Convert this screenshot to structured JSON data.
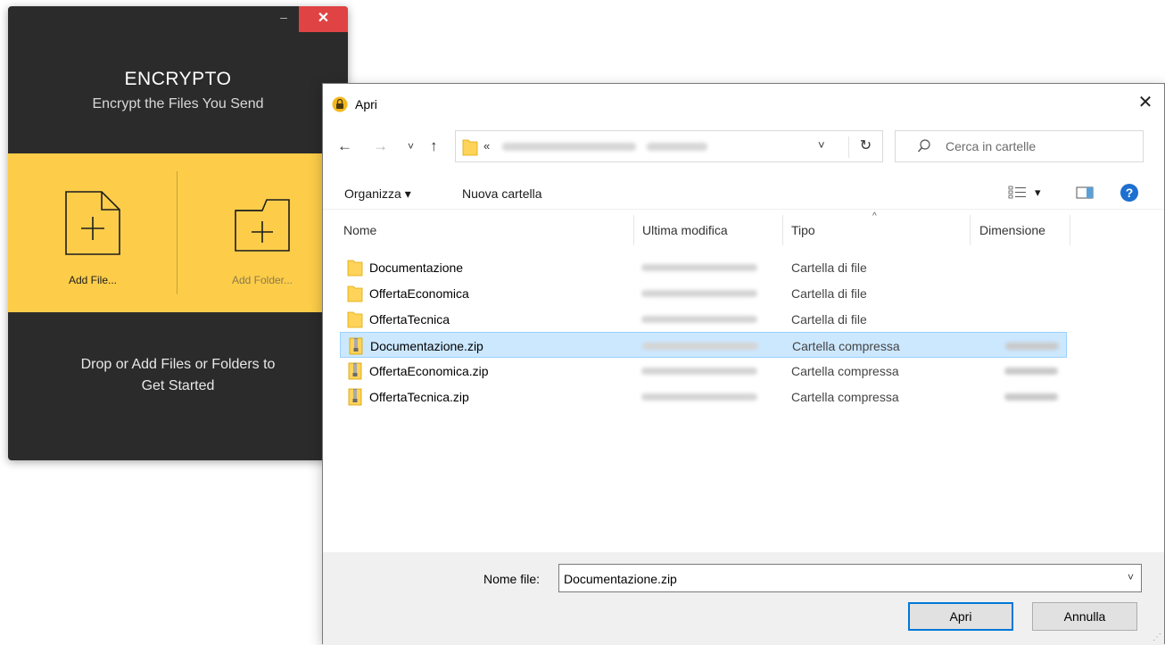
{
  "encrypto": {
    "minimize": "–",
    "close": "✕",
    "title": "ENCRYPTO",
    "subtitle": "Encrypt the Files You Send",
    "add_file": "Add File...",
    "add_folder": "Add Folder...",
    "hint_line1": "Drop or Add Files or Folders to",
    "hint_line2": "Get Started"
  },
  "dialog": {
    "title": "Apri",
    "close": "✕",
    "nav": {
      "back": "←",
      "forward": "→",
      "recent": "˅",
      "up": "↑",
      "path_prefix": "«",
      "dropdown": "˅",
      "refresh": "↻"
    },
    "search": {
      "placeholder": "Cerca in cartelle"
    },
    "toolbar": {
      "organize": "Organizza ▾",
      "new_folder": "Nuova cartella",
      "view_dropdown": "▾"
    },
    "columns": {
      "name": "Nome",
      "modified": "Ultima modifica",
      "type": "Tipo",
      "size": "Dimensione",
      "sort_caret": "^"
    },
    "files": [
      {
        "name": "Documentazione",
        "type": "Cartella di file",
        "kind": "folder",
        "selected": false
      },
      {
        "name": "OffertaEconomica",
        "type": "Cartella di file",
        "kind": "folder",
        "selected": false
      },
      {
        "name": "OffertaTecnica",
        "type": "Cartella di file",
        "kind": "folder",
        "selected": false
      },
      {
        "name": "Documentazione.zip",
        "type": "Cartella compressa",
        "kind": "zip",
        "selected": true
      },
      {
        "name": "OffertaEconomica.zip",
        "type": "Cartella compressa",
        "kind": "zip",
        "selected": false
      },
      {
        "name": "OffertaTecnica.zip",
        "type": "Cartella compressa",
        "kind": "zip",
        "selected": false
      }
    ],
    "footer": {
      "filename_label": "Nome file:",
      "filename_value": "Documentazione.zip",
      "filename_dropdown": "˅",
      "open_button": "Apri",
      "cancel_button": "Annulla"
    }
  },
  "colors": {
    "encrypto_bg": "#2b2b2b",
    "encrypto_accent": "#fdcd49",
    "close_red": "#e04343",
    "selection": "#cce8ff",
    "primary_border": "#0078d7"
  }
}
